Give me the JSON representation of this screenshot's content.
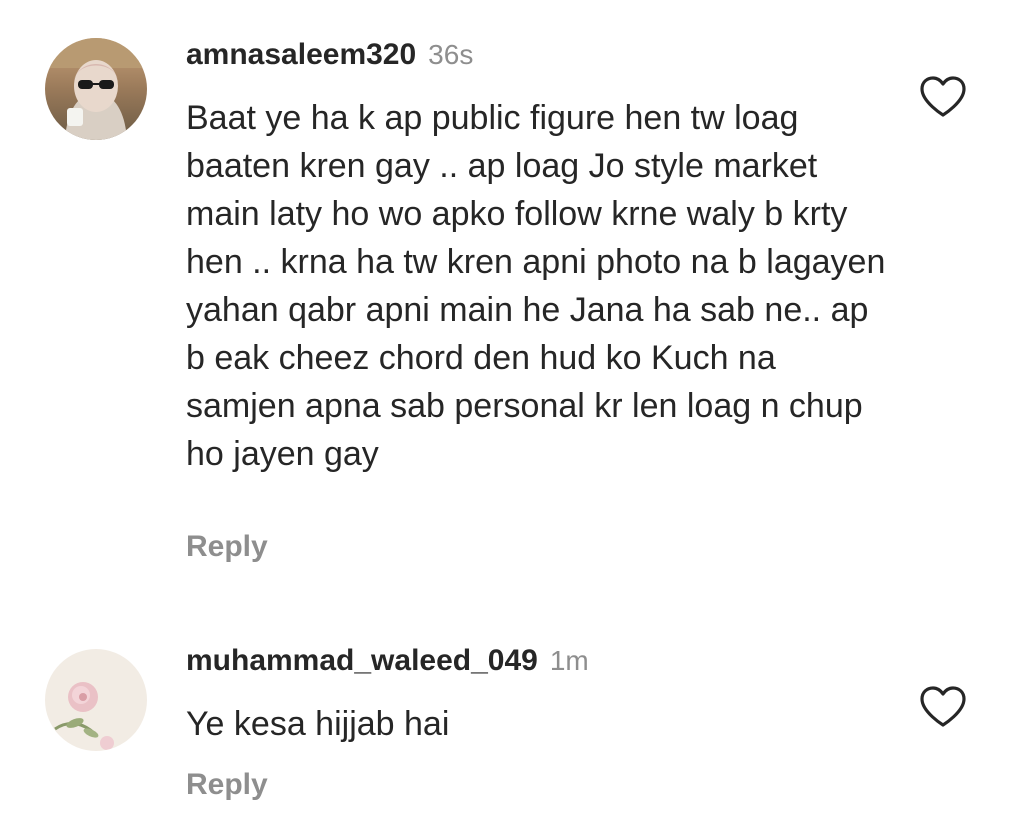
{
  "comments": [
    {
      "username": "amnasaleem320",
      "time": "36s",
      "text": "Baat ye ha k ap public figure hen tw loag baaten kren gay .. ap loag Jo style market main laty ho wo apko follow krne waly b krty hen .. krna ha tw kren apni photo na b lagayen yahan qabr apni main he Jana ha sab ne.. ap b eak cheez chord den hud ko Kuch na samjen apna sab personal kr len loag n chup ho jayen gay",
      "reply_label": "Reply",
      "avatar_icon": "profile-photo-woman-sunglasses",
      "like_icon": "heart-outline-icon"
    },
    {
      "username": "muhammad_waleed_049",
      "time": "1m",
      "text": "Ye kesa hijjab hai",
      "reply_label": "Reply",
      "avatar_icon": "profile-photo-rose",
      "like_icon": "heart-outline-icon"
    }
  ],
  "colors": {
    "primary_text": "#262626",
    "secondary_text": "#8e8e8e",
    "background": "#ffffff"
  }
}
